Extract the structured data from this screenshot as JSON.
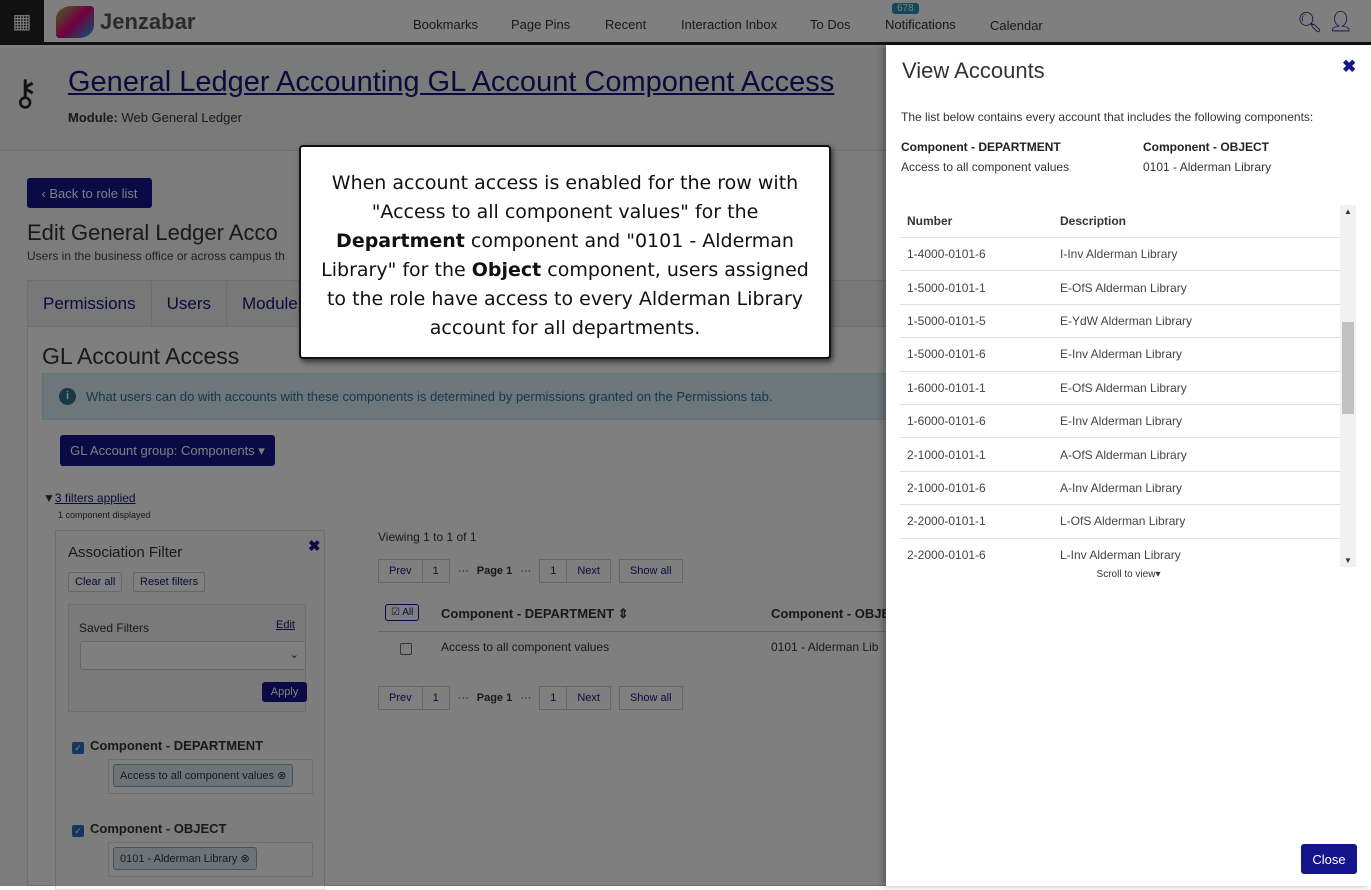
{
  "nav": {
    "items": [
      "Bookmarks",
      "Page Pins",
      "Recent",
      "Interaction Inbox",
      "To Dos",
      "Notifications",
      "Calendar"
    ],
    "notifications_count": "678",
    "logo": "Jenzabar"
  },
  "header": {
    "title": "General Ledger Accounting GL Account Component Access",
    "module_label": "Module:",
    "module_value": "Web General Ledger"
  },
  "main": {
    "back": "Back to role list",
    "edit_title": "Edit General Ledger Acco",
    "edit_sub": "Users in the business office or across campus th",
    "tabs": [
      "Permissions",
      "Users",
      "Module A"
    ],
    "section": "GL Account Access",
    "info": "What users can do with accounts with these components is determined by permissions granted on the Permissions tab.",
    "group_button": "GL Account group: Components",
    "filters_applied": "3 filters applied",
    "components_displayed": "1 component displayed",
    "viewing": "Viewing 1 to 1 of 1",
    "pager": {
      "prev": "Prev",
      "first": "1",
      "page": "Page 1",
      "last": "1",
      "next": "Next",
      "show_all": "Show all"
    },
    "table": {
      "all": "All",
      "col1": "Component - DEPARTMENT",
      "col2": "Component - OBJE",
      "row": {
        "c1": "Access to all component values",
        "c2": "0101 - Alderman Lib"
      }
    }
  },
  "filter": {
    "title": "Association Filter",
    "clear": "Clear all",
    "reset": "Reset filters",
    "saved": "Saved Filters",
    "edit": "Edit",
    "apply": "Apply",
    "dept_label": "Component - DEPARTMENT",
    "dept_chip": "Access to all component values",
    "obj_label": "Component - OBJECT",
    "obj_chip": "0101 - Alderman Library"
  },
  "callout": {
    "l1": "When account access is enabled for the row with \"Access to all component values\" for the ",
    "b1": "Department",
    "l2": " component and \"0101 - Alderman Library\" for the ",
    "b2": "Object",
    "l3": " component, users assigned to the role have access to every Alderman Library account for all departments."
  },
  "panel": {
    "title": "View Accounts",
    "desc": "The list below contains every account that includes the following components:",
    "comp1": {
      "label": "Component - DEPARTMENT",
      "value": "Access to all component values"
    },
    "comp2": {
      "label": "Component - OBJECT",
      "value": "0101 - Alderman Library"
    },
    "columns": [
      "Number",
      "Description"
    ],
    "rows": [
      [
        "1-4000-0101-6",
        "I-Inv Alderman Library"
      ],
      [
        "1-5000-0101-1",
        "E-OfS Alderman Library"
      ],
      [
        "1-5000-0101-5",
        "E-YdW Alderman Library"
      ],
      [
        "1-5000-0101-6",
        "E-Inv Alderman Library"
      ],
      [
        "1-6000-0101-1",
        "E-OfS Alderman Library"
      ],
      [
        "1-6000-0101-6",
        "E-Inv Alderman Library"
      ],
      [
        "2-1000-0101-1",
        "A-OfS Alderman Library"
      ],
      [
        "2-1000-0101-6",
        "A-Inv Alderman Library"
      ],
      [
        "2-2000-0101-1",
        "L-OfS Alderman Library"
      ],
      [
        "2-2000-0101-6",
        "L-Inv Alderman Library"
      ]
    ],
    "scroll_hint": "Scroll to view",
    "close": "Close"
  }
}
